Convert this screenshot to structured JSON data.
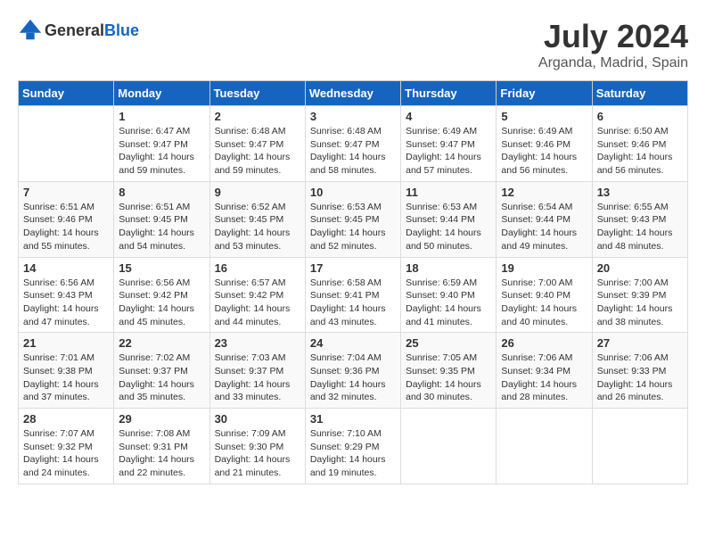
{
  "header": {
    "logo_general": "General",
    "logo_blue": "Blue",
    "month_year": "July 2024",
    "location": "Arganda, Madrid, Spain"
  },
  "days_of_week": [
    "Sunday",
    "Monday",
    "Tuesday",
    "Wednesday",
    "Thursday",
    "Friday",
    "Saturday"
  ],
  "weeks": [
    [
      {
        "day": "",
        "sunrise": "",
        "sunset": "",
        "daylight": ""
      },
      {
        "day": "1",
        "sunrise": "Sunrise: 6:47 AM",
        "sunset": "Sunset: 9:47 PM",
        "daylight": "Daylight: 14 hours and 59 minutes."
      },
      {
        "day": "2",
        "sunrise": "Sunrise: 6:48 AM",
        "sunset": "Sunset: 9:47 PM",
        "daylight": "Daylight: 14 hours and 59 minutes."
      },
      {
        "day": "3",
        "sunrise": "Sunrise: 6:48 AM",
        "sunset": "Sunset: 9:47 PM",
        "daylight": "Daylight: 14 hours and 58 minutes."
      },
      {
        "day": "4",
        "sunrise": "Sunrise: 6:49 AM",
        "sunset": "Sunset: 9:47 PM",
        "daylight": "Daylight: 14 hours and 57 minutes."
      },
      {
        "day": "5",
        "sunrise": "Sunrise: 6:49 AM",
        "sunset": "Sunset: 9:46 PM",
        "daylight": "Daylight: 14 hours and 56 minutes."
      },
      {
        "day": "6",
        "sunrise": "Sunrise: 6:50 AM",
        "sunset": "Sunset: 9:46 PM",
        "daylight": "Daylight: 14 hours and 56 minutes."
      }
    ],
    [
      {
        "day": "7",
        "sunrise": "Sunrise: 6:51 AM",
        "sunset": "Sunset: 9:46 PM",
        "daylight": "Daylight: 14 hours and 55 minutes."
      },
      {
        "day": "8",
        "sunrise": "Sunrise: 6:51 AM",
        "sunset": "Sunset: 9:45 PM",
        "daylight": "Daylight: 14 hours and 54 minutes."
      },
      {
        "day": "9",
        "sunrise": "Sunrise: 6:52 AM",
        "sunset": "Sunset: 9:45 PM",
        "daylight": "Daylight: 14 hours and 53 minutes."
      },
      {
        "day": "10",
        "sunrise": "Sunrise: 6:53 AM",
        "sunset": "Sunset: 9:45 PM",
        "daylight": "Daylight: 14 hours and 52 minutes."
      },
      {
        "day": "11",
        "sunrise": "Sunrise: 6:53 AM",
        "sunset": "Sunset: 9:44 PM",
        "daylight": "Daylight: 14 hours and 50 minutes."
      },
      {
        "day": "12",
        "sunrise": "Sunrise: 6:54 AM",
        "sunset": "Sunset: 9:44 PM",
        "daylight": "Daylight: 14 hours and 49 minutes."
      },
      {
        "day": "13",
        "sunrise": "Sunrise: 6:55 AM",
        "sunset": "Sunset: 9:43 PM",
        "daylight": "Daylight: 14 hours and 48 minutes."
      }
    ],
    [
      {
        "day": "14",
        "sunrise": "Sunrise: 6:56 AM",
        "sunset": "Sunset: 9:43 PM",
        "daylight": "Daylight: 14 hours and 47 minutes."
      },
      {
        "day": "15",
        "sunrise": "Sunrise: 6:56 AM",
        "sunset": "Sunset: 9:42 PM",
        "daylight": "Daylight: 14 hours and 45 minutes."
      },
      {
        "day": "16",
        "sunrise": "Sunrise: 6:57 AM",
        "sunset": "Sunset: 9:42 PM",
        "daylight": "Daylight: 14 hours and 44 minutes."
      },
      {
        "day": "17",
        "sunrise": "Sunrise: 6:58 AM",
        "sunset": "Sunset: 9:41 PM",
        "daylight": "Daylight: 14 hours and 43 minutes."
      },
      {
        "day": "18",
        "sunrise": "Sunrise: 6:59 AM",
        "sunset": "Sunset: 9:40 PM",
        "daylight": "Daylight: 14 hours and 41 minutes."
      },
      {
        "day": "19",
        "sunrise": "Sunrise: 7:00 AM",
        "sunset": "Sunset: 9:40 PM",
        "daylight": "Daylight: 14 hours and 40 minutes."
      },
      {
        "day": "20",
        "sunrise": "Sunrise: 7:00 AM",
        "sunset": "Sunset: 9:39 PM",
        "daylight": "Daylight: 14 hours and 38 minutes."
      }
    ],
    [
      {
        "day": "21",
        "sunrise": "Sunrise: 7:01 AM",
        "sunset": "Sunset: 9:38 PM",
        "daylight": "Daylight: 14 hours and 37 minutes."
      },
      {
        "day": "22",
        "sunrise": "Sunrise: 7:02 AM",
        "sunset": "Sunset: 9:37 PM",
        "daylight": "Daylight: 14 hours and 35 minutes."
      },
      {
        "day": "23",
        "sunrise": "Sunrise: 7:03 AM",
        "sunset": "Sunset: 9:37 PM",
        "daylight": "Daylight: 14 hours and 33 minutes."
      },
      {
        "day": "24",
        "sunrise": "Sunrise: 7:04 AM",
        "sunset": "Sunset: 9:36 PM",
        "daylight": "Daylight: 14 hours and 32 minutes."
      },
      {
        "day": "25",
        "sunrise": "Sunrise: 7:05 AM",
        "sunset": "Sunset: 9:35 PM",
        "daylight": "Daylight: 14 hours and 30 minutes."
      },
      {
        "day": "26",
        "sunrise": "Sunrise: 7:06 AM",
        "sunset": "Sunset: 9:34 PM",
        "daylight": "Daylight: 14 hours and 28 minutes."
      },
      {
        "day": "27",
        "sunrise": "Sunrise: 7:06 AM",
        "sunset": "Sunset: 9:33 PM",
        "daylight": "Daylight: 14 hours and 26 minutes."
      }
    ],
    [
      {
        "day": "28",
        "sunrise": "Sunrise: 7:07 AM",
        "sunset": "Sunset: 9:32 PM",
        "daylight": "Daylight: 14 hours and 24 minutes."
      },
      {
        "day": "29",
        "sunrise": "Sunrise: 7:08 AM",
        "sunset": "Sunset: 9:31 PM",
        "daylight": "Daylight: 14 hours and 22 minutes."
      },
      {
        "day": "30",
        "sunrise": "Sunrise: 7:09 AM",
        "sunset": "Sunset: 9:30 PM",
        "daylight": "Daylight: 14 hours and 21 minutes."
      },
      {
        "day": "31",
        "sunrise": "Sunrise: 7:10 AM",
        "sunset": "Sunset: 9:29 PM",
        "daylight": "Daylight: 14 hours and 19 minutes."
      },
      {
        "day": "",
        "sunrise": "",
        "sunset": "",
        "daylight": ""
      },
      {
        "day": "",
        "sunrise": "",
        "sunset": "",
        "daylight": ""
      },
      {
        "day": "",
        "sunrise": "",
        "sunset": "",
        "daylight": ""
      }
    ]
  ]
}
